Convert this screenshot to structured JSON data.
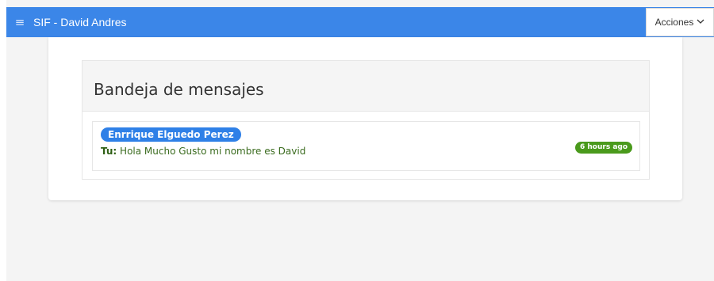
{
  "navbar": {
    "menu_icon": "hamburger-icon",
    "title": "SIF - David Andres",
    "acciones_label": "Acciones",
    "acciones_icon": "chevron-down-icon",
    "color": "#3b86e8"
  },
  "inbox": {
    "title": "Bandeja de mensajes",
    "messages": [
      {
        "sender": "Enrrique Elguedo Perez",
        "prefix": "Tu:",
        "text": "Hola Mucho Gusto mi nombre es David",
        "time": "6 hours ago",
        "sender_color": "#2f80e7",
        "time_color": "#4a9a1c"
      }
    ]
  }
}
